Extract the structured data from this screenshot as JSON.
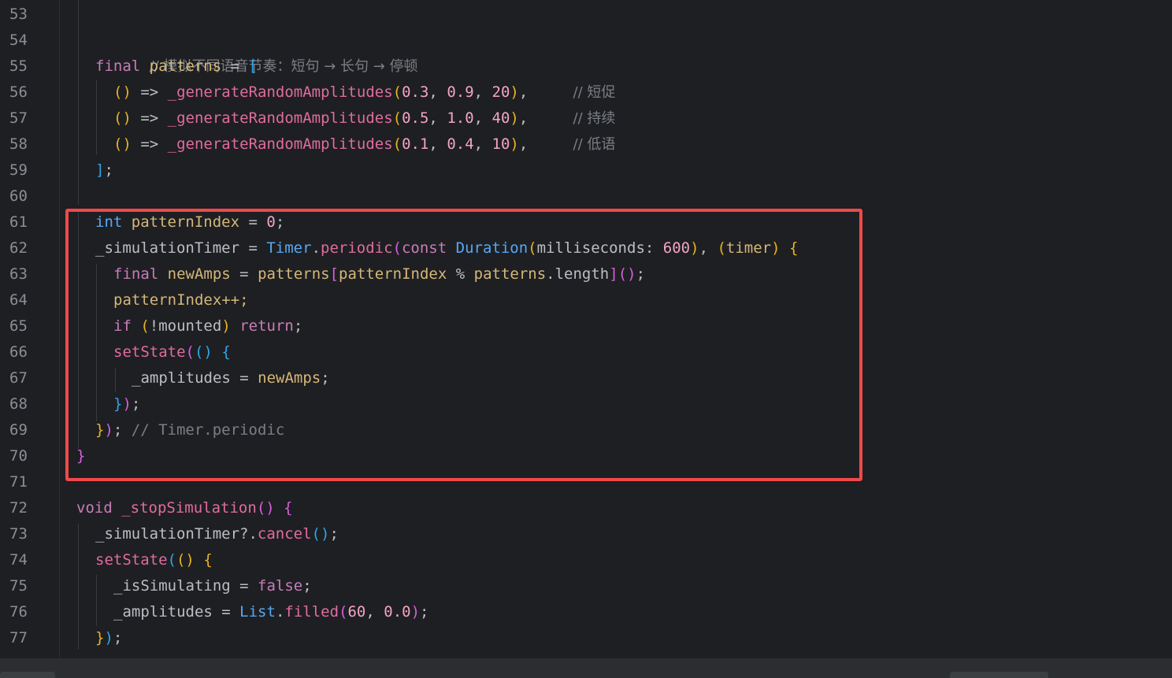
{
  "editor": {
    "line_numbers": [
      "53",
      "54",
      "55",
      "56",
      "57",
      "58",
      "59",
      "60",
      "61",
      "62",
      "63",
      "64",
      "65",
      "66",
      "67",
      "68",
      "69",
      "70",
      "71",
      "72",
      "73",
      "74",
      "75",
      "76",
      "77"
    ],
    "lines": {
      "l54_comment": "// 模拟不同语音节奏：短句 → 长句 → 停顿",
      "l55_final": "final",
      "l55_name": "patterns",
      "l55_eq": " = ",
      "l55_open": "[",
      "l56_paren": "()",
      "l56_arrow": " => ",
      "l56_fn": "_generateRandomAmplitudes",
      "l56_a": "0.3",
      "l56_b": "0.9",
      "l56_c": "20",
      "l56_comment": "// 短促",
      "l57_a": "0.5",
      "l57_b": "1.0",
      "l57_c": "40",
      "l57_comment": "// 持续",
      "l58_a": "0.1",
      "l58_b": "0.4",
      "l58_c": "10",
      "l58_comment": "// 低语",
      "l59_close": "]",
      "l59_semi": ";",
      "l61_int": "int",
      "l61_name": "patternIndex",
      "l61_eq": " = ",
      "l61_val": "0",
      "l61_semi": ";",
      "l62_var": "_simulationTimer",
      "l62_eq": " = ",
      "l62_timer": "Timer",
      "l62_dot": ".",
      "l62_periodic": "periodic",
      "l62_const": "const",
      "l62_duration": "Duration",
      "l62_ms": "milliseconds",
      "l62_colon": ": ",
      "l62_val": "600",
      "l62_param": "timer",
      "l63_final": "final",
      "l63_name": "newAmps",
      "l63_eq": " = ",
      "l63_patterns": "patterns",
      "l63_idx": "patternIndex",
      "l63_mod": " % ",
      "l63_patterns2": "patterns",
      "l63_length": "length",
      "l64_text": "patternIndex++;",
      "l65_if": "if",
      "l65_cond": "!mounted",
      "l65_return": "return",
      "l66_setstate": "setState",
      "l67_var": "_amplitudes",
      "l67_eq": " = ",
      "l67_val": "newAmps",
      "l69_comment": "// Timer.periodic",
      "l72_void": "void",
      "l72_fn": "_stopSimulation",
      "l73_var": "_simulationTimer?.",
      "l73_cancel": "cancel",
      "l74_setstate": "setState",
      "l75_var": "_isSimulating",
      "l75_eq": " = ",
      "l75_val": "false",
      "l76_var": "_amplitudes",
      "l76_eq": " = ",
      "l76_list": "List",
      "l76_filled": "filled",
      "l76_a": "60",
      "l76_b": "0.0"
    }
  },
  "colors": {
    "background": "#1e1f22",
    "highlight_border": "#f0494a"
  }
}
